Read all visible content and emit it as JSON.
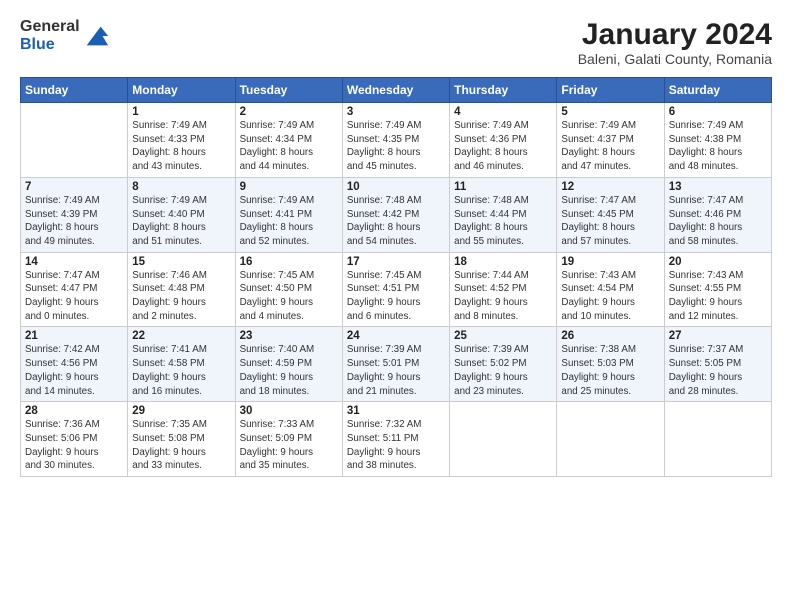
{
  "header": {
    "logo_line1": "General",
    "logo_line2": "Blue",
    "title": "January 2024",
    "subtitle": "Baleni, Galati County, Romania"
  },
  "weekdays": [
    "Sunday",
    "Monday",
    "Tuesday",
    "Wednesday",
    "Thursday",
    "Friday",
    "Saturday"
  ],
  "weeks": [
    [
      {
        "day": "",
        "detail": ""
      },
      {
        "day": "1",
        "detail": "Sunrise: 7:49 AM\nSunset: 4:33 PM\nDaylight: 8 hours\nand 43 minutes."
      },
      {
        "day": "2",
        "detail": "Sunrise: 7:49 AM\nSunset: 4:34 PM\nDaylight: 8 hours\nand 44 minutes."
      },
      {
        "day": "3",
        "detail": "Sunrise: 7:49 AM\nSunset: 4:35 PM\nDaylight: 8 hours\nand 45 minutes."
      },
      {
        "day": "4",
        "detail": "Sunrise: 7:49 AM\nSunset: 4:36 PM\nDaylight: 8 hours\nand 46 minutes."
      },
      {
        "day": "5",
        "detail": "Sunrise: 7:49 AM\nSunset: 4:37 PM\nDaylight: 8 hours\nand 47 minutes."
      },
      {
        "day": "6",
        "detail": "Sunrise: 7:49 AM\nSunset: 4:38 PM\nDaylight: 8 hours\nand 48 minutes."
      }
    ],
    [
      {
        "day": "7",
        "detail": "Sunrise: 7:49 AM\nSunset: 4:39 PM\nDaylight: 8 hours\nand 49 minutes."
      },
      {
        "day": "8",
        "detail": "Sunrise: 7:49 AM\nSunset: 4:40 PM\nDaylight: 8 hours\nand 51 minutes."
      },
      {
        "day": "9",
        "detail": "Sunrise: 7:49 AM\nSunset: 4:41 PM\nDaylight: 8 hours\nand 52 minutes."
      },
      {
        "day": "10",
        "detail": "Sunrise: 7:48 AM\nSunset: 4:42 PM\nDaylight: 8 hours\nand 54 minutes."
      },
      {
        "day": "11",
        "detail": "Sunrise: 7:48 AM\nSunset: 4:44 PM\nDaylight: 8 hours\nand 55 minutes."
      },
      {
        "day": "12",
        "detail": "Sunrise: 7:47 AM\nSunset: 4:45 PM\nDaylight: 8 hours\nand 57 minutes."
      },
      {
        "day": "13",
        "detail": "Sunrise: 7:47 AM\nSunset: 4:46 PM\nDaylight: 8 hours\nand 58 minutes."
      }
    ],
    [
      {
        "day": "14",
        "detail": "Sunrise: 7:47 AM\nSunset: 4:47 PM\nDaylight: 9 hours\nand 0 minutes."
      },
      {
        "day": "15",
        "detail": "Sunrise: 7:46 AM\nSunset: 4:48 PM\nDaylight: 9 hours\nand 2 minutes."
      },
      {
        "day": "16",
        "detail": "Sunrise: 7:45 AM\nSunset: 4:50 PM\nDaylight: 9 hours\nand 4 minutes."
      },
      {
        "day": "17",
        "detail": "Sunrise: 7:45 AM\nSunset: 4:51 PM\nDaylight: 9 hours\nand 6 minutes."
      },
      {
        "day": "18",
        "detail": "Sunrise: 7:44 AM\nSunset: 4:52 PM\nDaylight: 9 hours\nand 8 minutes."
      },
      {
        "day": "19",
        "detail": "Sunrise: 7:43 AM\nSunset: 4:54 PM\nDaylight: 9 hours\nand 10 minutes."
      },
      {
        "day": "20",
        "detail": "Sunrise: 7:43 AM\nSunset: 4:55 PM\nDaylight: 9 hours\nand 12 minutes."
      }
    ],
    [
      {
        "day": "21",
        "detail": "Sunrise: 7:42 AM\nSunset: 4:56 PM\nDaylight: 9 hours\nand 14 minutes."
      },
      {
        "day": "22",
        "detail": "Sunrise: 7:41 AM\nSunset: 4:58 PM\nDaylight: 9 hours\nand 16 minutes."
      },
      {
        "day": "23",
        "detail": "Sunrise: 7:40 AM\nSunset: 4:59 PM\nDaylight: 9 hours\nand 18 minutes."
      },
      {
        "day": "24",
        "detail": "Sunrise: 7:39 AM\nSunset: 5:01 PM\nDaylight: 9 hours\nand 21 minutes."
      },
      {
        "day": "25",
        "detail": "Sunrise: 7:39 AM\nSunset: 5:02 PM\nDaylight: 9 hours\nand 23 minutes."
      },
      {
        "day": "26",
        "detail": "Sunrise: 7:38 AM\nSunset: 5:03 PM\nDaylight: 9 hours\nand 25 minutes."
      },
      {
        "day": "27",
        "detail": "Sunrise: 7:37 AM\nSunset: 5:05 PM\nDaylight: 9 hours\nand 28 minutes."
      }
    ],
    [
      {
        "day": "28",
        "detail": "Sunrise: 7:36 AM\nSunset: 5:06 PM\nDaylight: 9 hours\nand 30 minutes."
      },
      {
        "day": "29",
        "detail": "Sunrise: 7:35 AM\nSunset: 5:08 PM\nDaylight: 9 hours\nand 33 minutes."
      },
      {
        "day": "30",
        "detail": "Sunrise: 7:33 AM\nSunset: 5:09 PM\nDaylight: 9 hours\nand 35 minutes."
      },
      {
        "day": "31",
        "detail": "Sunrise: 7:32 AM\nSunset: 5:11 PM\nDaylight: 9 hours\nand 38 minutes."
      },
      {
        "day": "",
        "detail": ""
      },
      {
        "day": "",
        "detail": ""
      },
      {
        "day": "",
        "detail": ""
      }
    ]
  ]
}
